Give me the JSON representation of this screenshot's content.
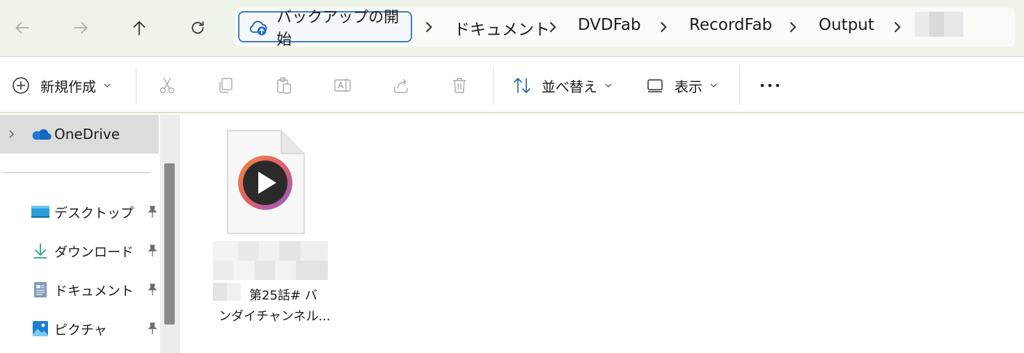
{
  "nav": {
    "back_icon": "arrow-left-icon",
    "forward_icon": "arrow-right-icon",
    "up_icon": "arrow-up-icon",
    "refresh_icon": "refresh-icon"
  },
  "address_bar": {
    "backup_label": "バックアップの開始",
    "crumbs": [
      "ドキュメント",
      "DVDFab",
      "RecordFab",
      "Output"
    ]
  },
  "toolbar": {
    "new_label": "新規作成",
    "sort_label": "並べ替え",
    "view_label": "表示"
  },
  "sidebar": {
    "onedrive_label": "OneDrive",
    "quick_access": [
      {
        "label": "デスクトップ",
        "icon": "desktop-icon"
      },
      {
        "label": "ダウンロード",
        "icon": "download-icon"
      },
      {
        "label": "ドキュメント",
        "icon": "document-icon"
      },
      {
        "label": "ピクチャ",
        "icon": "pictures-icon"
      }
    ]
  },
  "content": {
    "files": [
      {
        "name_line1": "第25話# バ",
        "name_line2": "ンダイチャンネル...",
        "icon": "video-file-icon"
      }
    ]
  },
  "colors": {
    "nav_bg": "#eff4ea",
    "accent_border": "#3e7bbf",
    "onedrive_blue": "#1f7ad6",
    "sidebar_selected": "#dcdcdc"
  }
}
